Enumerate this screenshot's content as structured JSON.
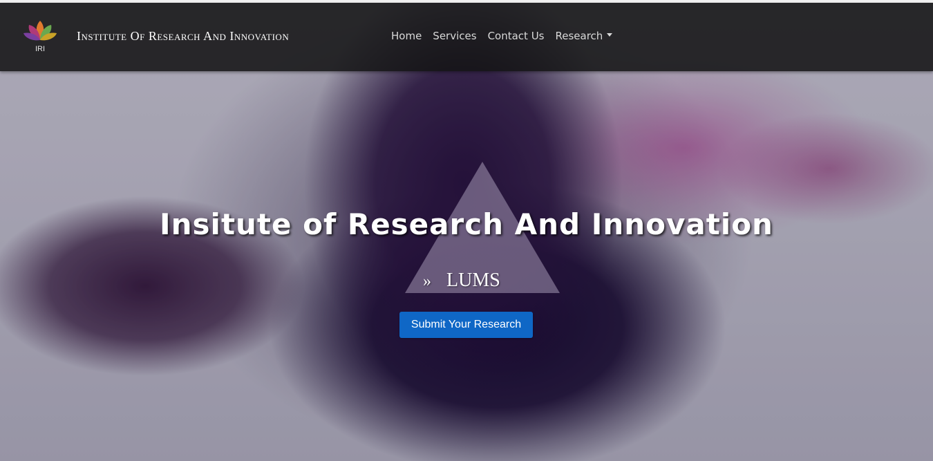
{
  "header": {
    "logo_caption": "IRI",
    "brand_title": "Institute Of Research And Innovation",
    "nav": [
      {
        "label": "Home"
      },
      {
        "label": "Services"
      },
      {
        "label": "Contact Us"
      },
      {
        "label": "Research",
        "has_dropdown": true
      }
    ]
  },
  "hero": {
    "title": "Insitute of Research And Innovation",
    "subtitle_prefix": "»",
    "subtitle": "LUMS",
    "cta_label": "Submit Your Research"
  },
  "colors": {
    "navbar_bg": "#141416",
    "cta_bg": "#0f67c6",
    "text": "#ffffff"
  },
  "icons": {
    "logo": "lotus-logo-icon",
    "dropdown": "caret-down-icon",
    "backdrop": "triangle-icon"
  }
}
